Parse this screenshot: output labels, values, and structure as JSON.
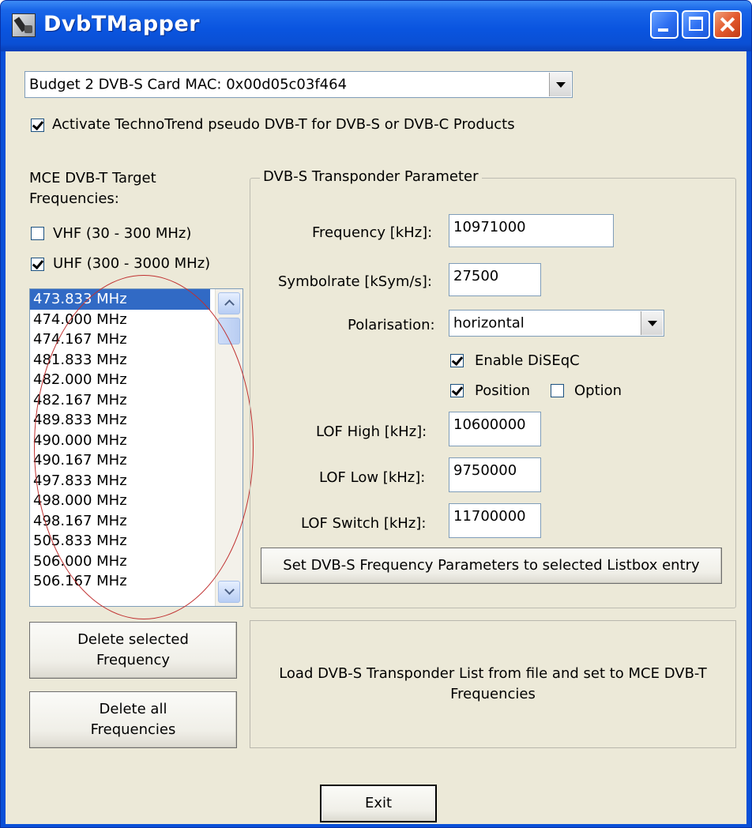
{
  "window": {
    "title": "DvbTMapper"
  },
  "device_select": {
    "value": "Budget 2 DVB-S Card MAC: 0x00d05c03f464"
  },
  "activate_checkbox": {
    "label": "Activate TechnoTrend pseudo DVB-T for DVB-S or DVB-C Products",
    "checked": true
  },
  "target_freq": {
    "title_line1": "MCE DVB-T Target",
    "title_line2": "Frequencies:",
    "vhf_label": "VHF (30 - 300 MHz)",
    "vhf_checked": false,
    "uhf_label": "UHF (300 - 3000 MHz)",
    "uhf_checked": true
  },
  "frequency_list": {
    "selected_index": 0,
    "items": [
      "473.833 MHz",
      "474.000 MHz",
      "474.167 MHz",
      "481.833 MHz",
      "482.000 MHz",
      "482.167 MHz",
      "489.833 MHz",
      "490.000 MHz",
      "490.167 MHz",
      "497.833 MHz",
      "498.000 MHz",
      "498.167 MHz",
      "505.833 MHz",
      "506.000 MHz",
      "506.167 MHz"
    ]
  },
  "transponder": {
    "group_title": "DVB-S Transponder Parameter",
    "frequency_label": "Frequency [kHz]:",
    "frequency_value": "10971000",
    "symbolrate_label": "Symbolrate [kSym/s]:",
    "symbolrate_value": "27500",
    "polarisation_label": "Polarisation:",
    "polarisation_value": "horizontal",
    "diseqc_label": "Enable DiSEqC",
    "diseqc_checked": true,
    "position_label": "Position",
    "position_checked": true,
    "option_label": "Option",
    "option_checked": false,
    "lof_high_label": "LOF High [kHz]:",
    "lof_high_value": "10600000",
    "lof_low_label": "LOF Low [kHz]:",
    "lof_low_value": "9750000",
    "lof_switch_label": "LOF Switch [kHz]:",
    "lof_switch_value": "11700000",
    "set_button": "Set DVB-S Frequency Parameters to selected Listbox entry"
  },
  "buttons": {
    "delete_selected_line1": "Delete selected",
    "delete_selected_line2": "Frequency",
    "delete_all_line1": "Delete all",
    "delete_all_line2": "Frequencies",
    "load_line1": "Load DVB-S Transponder List from file and set to MCE DVB-T",
    "load_line2": "Frequencies",
    "exit": "Exit"
  },
  "icons": {
    "app": "app-icon",
    "minimize": "minimize-icon",
    "maximize": "maximize-icon",
    "close": "close-icon"
  },
  "colors": {
    "titlebar": "#0a50d8",
    "client": "#ece9d8",
    "selection": "#316ac5",
    "annotation": "#c03030"
  }
}
